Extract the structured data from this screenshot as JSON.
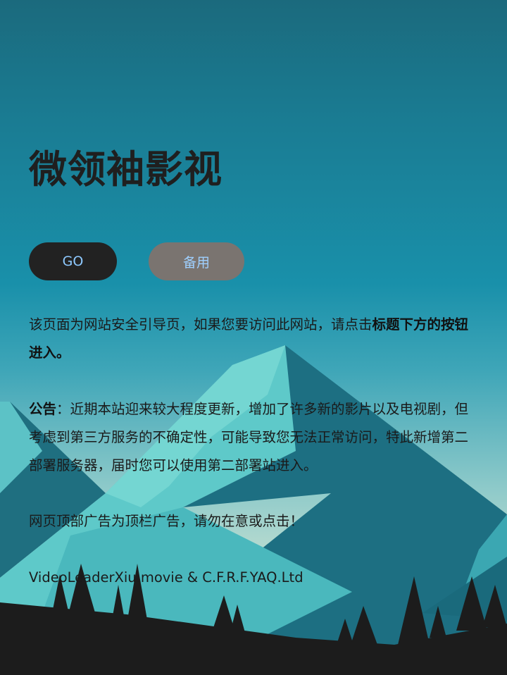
{
  "page": {
    "title": "微领袖影视"
  },
  "buttons": {
    "go_label": "GO",
    "backup_label": "备用"
  },
  "notice": {
    "intro_text": "该页面为网站安全引导页，如果您要访问此网站，请点击",
    "intro_bold": "标题下方的按钮进入。",
    "announcement_label": "公告",
    "announcement_text": "：近期本站迎来较大程度更新，增加了许多新的影片以及电视剧，但考虑到第三方服务的不确定性，可能导致您无法正常访问，特此新增第二部署服务器，届时您可以使用第二部署站进入。",
    "ad_warning": "网页顶部广告为顶栏广告，请勿在意或点击！"
  },
  "footer": {
    "credits": "VideoLeaderXiu.movie & C.F.R.F.YAQ.Ltd"
  },
  "colors": {
    "bg_top": "#1b6a7d",
    "bg_mid": "#1990aa",
    "mountain_light": "#6ad0d0",
    "mountain_dark": "#1e7082",
    "tree": "#1c1c1c",
    "go_button": "#222222",
    "backup_button": "#7a7470",
    "button_text": "#8ec9ff"
  },
  "icons": {
    "background": "mountain-landscape-illustration"
  }
}
